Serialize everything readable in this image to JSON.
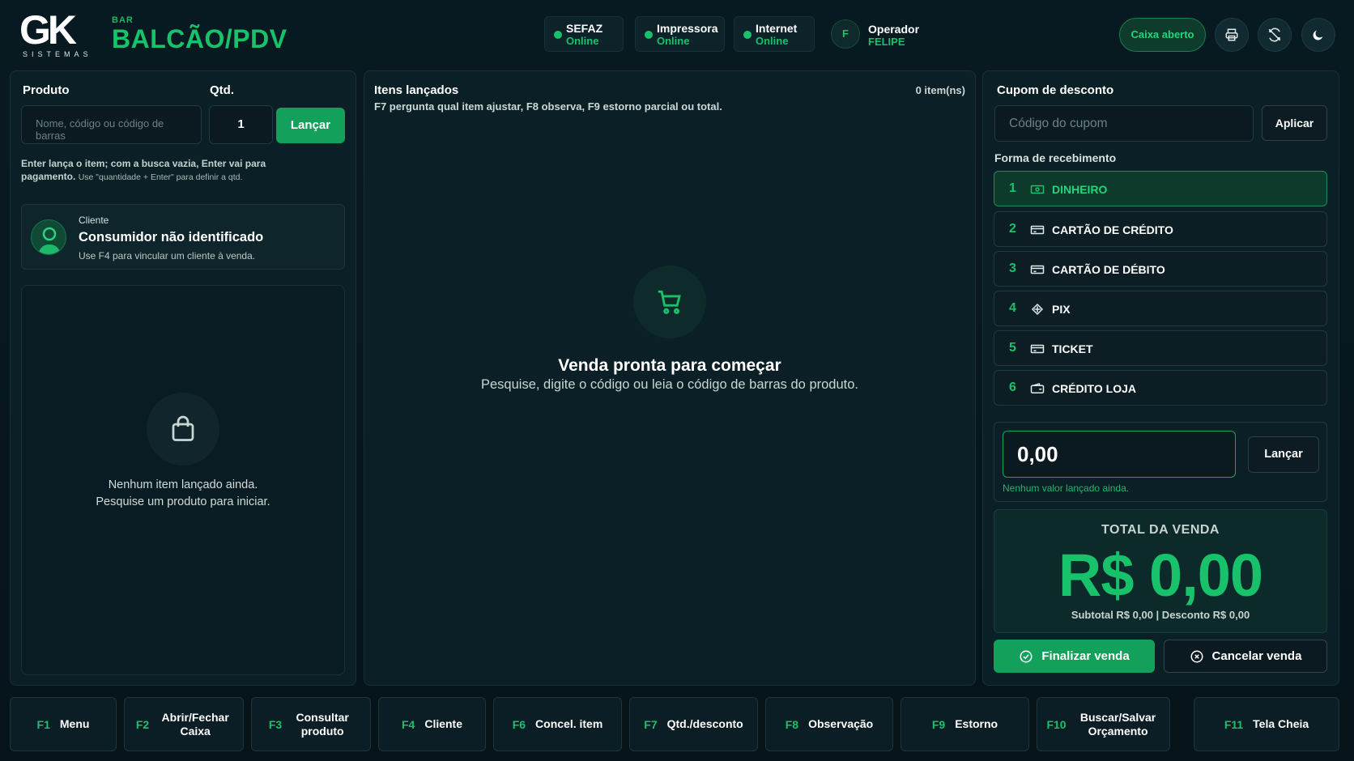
{
  "header": {
    "logo_text": "GK",
    "logo_sub": "SISTEMAS",
    "brand_small": "BAR",
    "brand_title": "BALCÃO/PDV",
    "status": [
      {
        "label": "SEFAZ",
        "value": "Online"
      },
      {
        "label": "Impressora",
        "value": "Online"
      },
      {
        "label": "Internet",
        "value": "Online"
      }
    ],
    "operator": {
      "initial": "F",
      "label": "Operador",
      "name": "FELIPE"
    },
    "caixa_label": "Caixa aberto",
    "icons": [
      "printer-icon",
      "sync-icon",
      "moon-icon"
    ]
  },
  "product": {
    "title": "Produto",
    "qty_title": "Qtd.",
    "search_placeholder": "Nome, código ou código de barras",
    "qty_value": "1",
    "launch_label": "Lançar",
    "hint_bold": "Enter lança o item; com a busca vazia, Enter vai para pagamento.",
    "hint_small": "Use \"quantidade + Enter\" para definir a qtd."
  },
  "client": {
    "label": "Cliente",
    "name": "Consumidor não identificado",
    "hint": "Use F4 para vincular um cliente à venda."
  },
  "left_empty": {
    "line1": "Nenhum item lançado ainda.",
    "line2": "Pesquise um produto para iniciar."
  },
  "items": {
    "title": "Itens lançados",
    "subtitle": "F7 pergunta qual item ajustar, F8 observa, F9 estorno parcial ou total.",
    "count": "0 item(ns)",
    "empty_title": "Venda pronta para começar",
    "empty_sub": "Pesquise, digite o código ou leia o código de barras do produto."
  },
  "coupon": {
    "title": "Cupom de desconto",
    "placeholder": "Código do cupom",
    "apply_label": "Aplicar"
  },
  "payment": {
    "title": "Forma de recebimento",
    "methods": [
      {
        "num": "1",
        "label": "DINHEIRO",
        "icon": "cash-icon"
      },
      {
        "num": "2",
        "label": "CARTÃO DE CRÉDITO",
        "icon": "card-icon"
      },
      {
        "num": "3",
        "label": "CARTÃO DE DÉBITO",
        "icon": "card-icon"
      },
      {
        "num": "4",
        "label": "PIX",
        "icon": "pix-icon"
      },
      {
        "num": "5",
        "label": "TICKET",
        "icon": "card-icon"
      },
      {
        "num": "6",
        "label": "CRÉDITO LOJA",
        "icon": "wallet-icon"
      }
    ],
    "amount_value": "0,00",
    "amount_launch": "Lançar",
    "amount_hint": "Nenhum valor lançado ainda."
  },
  "total": {
    "label": "TOTAL DA VENDA",
    "value": "R$ 0,00",
    "subtotal": "Subtotal R$ 0,00 | Desconto R$ 0,00"
  },
  "actions": {
    "finalize": "Finalizar venda",
    "cancel": "Cancelar venda"
  },
  "fkeys": [
    {
      "key": "F1",
      "label": "Menu"
    },
    {
      "key": "F2",
      "label": "Abrir/Fechar Caixa"
    },
    {
      "key": "F3",
      "label": "Consultar produto"
    },
    {
      "key": "F4",
      "label": "Cliente"
    },
    {
      "key": "F6",
      "label": "Concel. item"
    },
    {
      "key": "F7",
      "label": "Qtd./desconto"
    },
    {
      "key": "F8",
      "label": "Observação"
    },
    {
      "key": "F9",
      "label": "Estorno"
    },
    {
      "key": "F10",
      "label": "Buscar/Salvar Orçamento"
    },
    {
      "key": "F11",
      "label": "Tela Cheia"
    }
  ],
  "colors": {
    "accent": "#17c26b",
    "background": "#07161d",
    "panel": "#0b1f26"
  }
}
